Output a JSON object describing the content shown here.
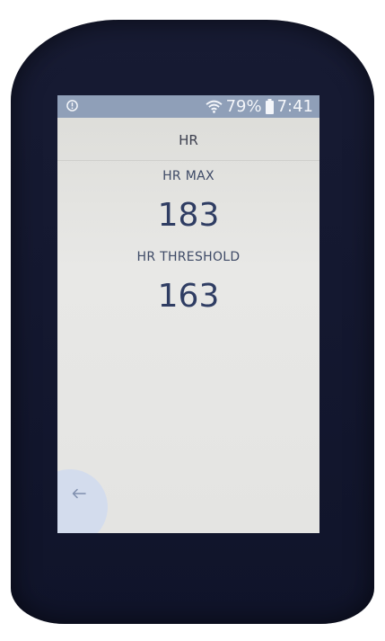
{
  "status": {
    "battery_percent": "79%",
    "time": "7:41",
    "icons": [
      "alert-icon",
      "wifi-icon",
      "battery-icon"
    ]
  },
  "screen": {
    "title": "HR"
  },
  "fields": [
    {
      "label": "HR MAX",
      "value": "183"
    },
    {
      "label": "HR THRESHOLD",
      "value": "163"
    }
  ],
  "navigation": {
    "back_icon": "back-arrow-icon"
  },
  "colors": {
    "device_body": "#141830",
    "status_bar": "#8f9fb8",
    "screen_background": "#e6e6e4",
    "value_text": "#2f3d63"
  }
}
